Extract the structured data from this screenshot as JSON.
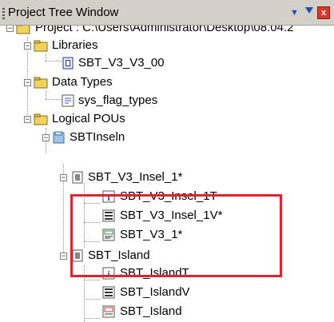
{
  "window": {
    "title": "Project Tree Window",
    "close_glyph": "x"
  },
  "tree": {
    "project": "Project : C:\\Users\\Administrator\\Desktop\\08.04.2",
    "libraries": "Libraries",
    "library_item": "SBT_V3_V3_00",
    "data_types": "Data Types",
    "data_type_item": "sys_flag_types",
    "logical_pous": "Logical POUs",
    "folder_sbtinseln": "SBTInseln",
    "pou_insel_1": "SBT_V3_Insel_1*",
    "insel_1t": "SBT_V3_Insel_1T",
    "insel_1v": "SBT_V3_Insel_1V*",
    "v3_1": "SBT_V3_1*",
    "pou_island": "SBT_Island",
    "island_t": "SBT_IslandT",
    "island_v": "SBT_IslandV",
    "island": "SBT_Island"
  },
  "colors": {
    "highlight": "#e0232e",
    "folder": "#f2d35a"
  },
  "icons": [
    "pin-icon",
    "dropdown-icon",
    "close-icon",
    "project-folder-icon",
    "folder-icon",
    "library-book-icon",
    "datatype-icon",
    "pou-icon",
    "header-info-icon",
    "variables-icon",
    "body-icon"
  ]
}
